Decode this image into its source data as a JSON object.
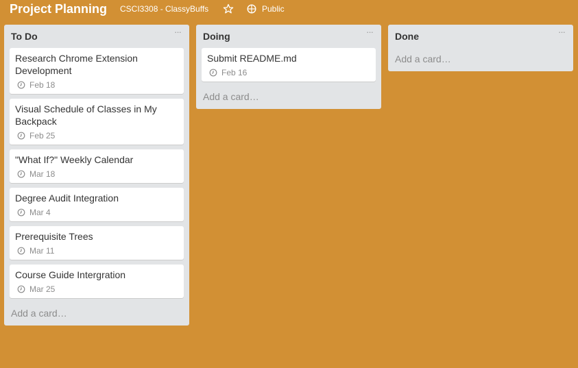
{
  "header": {
    "board_title": "Project Planning",
    "organization": "CSCI3308 - ClassyBuffs",
    "star_icon": "star-outline-icon",
    "visibility_icon": "globe-icon",
    "visibility": "Public"
  },
  "colors": {
    "board_background": "#d29034",
    "list_background": "#e2e4e6",
    "card_background": "#ffffff"
  },
  "lists": [
    {
      "title": "To Do",
      "menu": "···",
      "add_card": "Add a card…",
      "cards": [
        {
          "title": "Research Chrome Extension Development",
          "due": "Feb 18"
        },
        {
          "title": "Visual Schedule of Classes in My Backpack",
          "due": "Feb 25"
        },
        {
          "title": "\"What If?\" Weekly Calendar",
          "due": "Mar 18"
        },
        {
          "title": "Degree Audit Integration",
          "due": "Mar 4"
        },
        {
          "title": "Prerequisite Trees",
          "due": "Mar 11"
        },
        {
          "title": "Course Guide Intergration",
          "due": "Mar 25"
        }
      ]
    },
    {
      "title": "Doing",
      "menu": "···",
      "add_card": "Add a card…",
      "cards": [
        {
          "title": "Submit README.md",
          "due": "Feb 16"
        }
      ]
    },
    {
      "title": "Done",
      "menu": "···",
      "add_card": "Add a card…",
      "cards": []
    }
  ]
}
